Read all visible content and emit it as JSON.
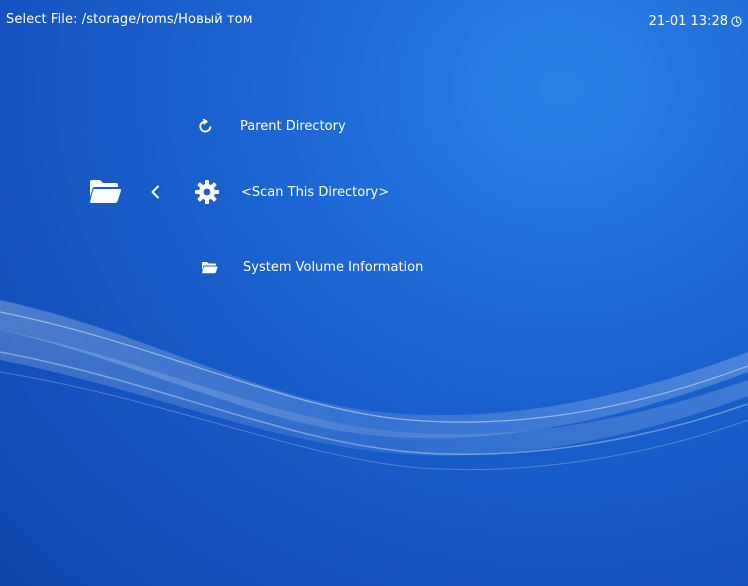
{
  "header": {
    "title": "Select File: /storage/roms/Новый том"
  },
  "clock": {
    "time": "21-01 13:28",
    "icon": "clock-icon"
  },
  "sidebar": {
    "tab_icon": "folder-open-icon",
    "arrow_icon": "chevron-left-icon"
  },
  "file_list": {
    "items": [
      {
        "label": "Parent Directory",
        "icon": "refresh-icon"
      },
      {
        "label": "<Scan This Directory>",
        "icon": "gear-icon",
        "selected": true
      },
      {
        "label": "System Volume Information",
        "icon": "folder-icon"
      }
    ]
  },
  "colors": {
    "background": "#1a5fcc",
    "text": "#ffffff"
  }
}
